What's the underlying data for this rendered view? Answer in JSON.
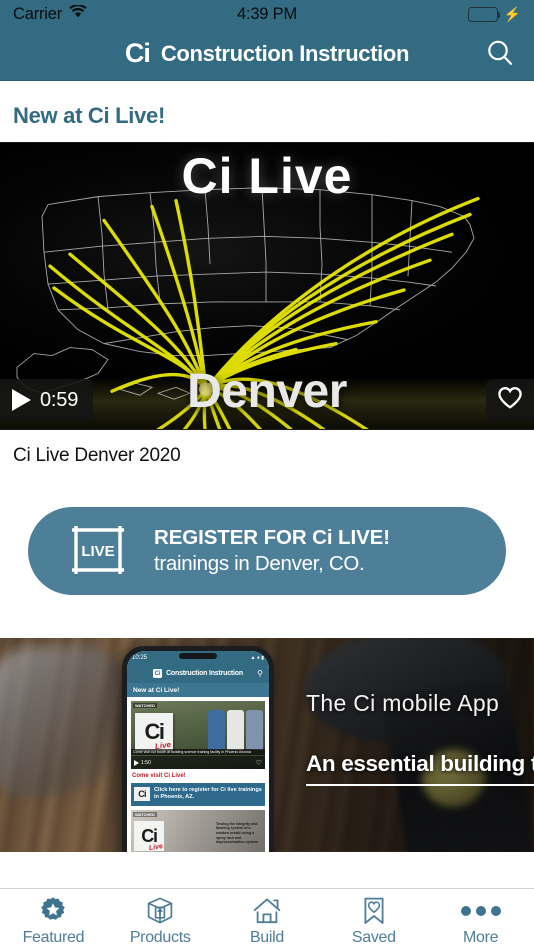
{
  "status_bar": {
    "carrier": "Carrier",
    "wifi_icon": "wifi-icon",
    "time": "4:39 PM",
    "battery_icon": "battery-full-icon",
    "charging_icon": "lightning-bolt-icon",
    "text_color": "#0d0d0d"
  },
  "nav_bar": {
    "logo_text": "Ci",
    "title": "Construction Instruction",
    "search_icon": "search-icon",
    "background": "#336b83"
  },
  "main": {
    "section_heading": "New at Ci Live!",
    "heading_color": "#336b83",
    "video_card": {
      "overlay_title_top": "Ci Live",
      "overlay_title_bottom": "Denver",
      "duration": "0:59",
      "play_icon": "play-icon",
      "favorite_icon": "heart-outline-icon",
      "caption": "Ci Live Denver 2020",
      "map_accent_color": "#e8e800"
    },
    "cta_button": {
      "icon_label": "LIVE",
      "icon_name": "live-frame-icon",
      "line1": "REGISTER FOR Ci LIVE!",
      "line2": "trainings in Denver, CO.",
      "background": "#4d7f99"
    },
    "promo_banner": {
      "headline": "The Ci mobile App",
      "subheadline": "An essential building tool",
      "phone_mockup": {
        "status_time": "10:25",
        "nav_logo": "Ci",
        "nav_title": "Construction Instruction",
        "section_heading": "New at Ci Live!",
        "video_tag": "WATCHED",
        "video_logo": "Ci",
        "video_live": "Live",
        "video_strip_text": "Come visit our booth at building science training facility in Phoenix Arizona",
        "video_duration": "1:50",
        "caption": "Come visit Ci Live!",
        "banner_logo": "Ci",
        "banner_text": "Click here to register for Ci live trainings in Phoenix, AZ.",
        "card2_tag": "WATCHED",
        "card2_logo": "Ci",
        "card2_live": "Live",
        "card2_text": "Testing the integrity and flashing system of a window install using a spray rack and depressurization system"
      }
    }
  },
  "tab_bar": {
    "items": [
      {
        "label": "Featured",
        "icon": "star-badge-icon",
        "active": true
      },
      {
        "label": "Products",
        "icon": "box-package-icon",
        "active": false
      },
      {
        "label": "Build",
        "icon": "house-icon",
        "active": false
      },
      {
        "label": "Saved",
        "icon": "bookmark-heart-icon",
        "active": false
      },
      {
        "label": "More",
        "icon": "three-dots-icon",
        "active": false
      }
    ],
    "tint_color": "#4e7e98"
  }
}
